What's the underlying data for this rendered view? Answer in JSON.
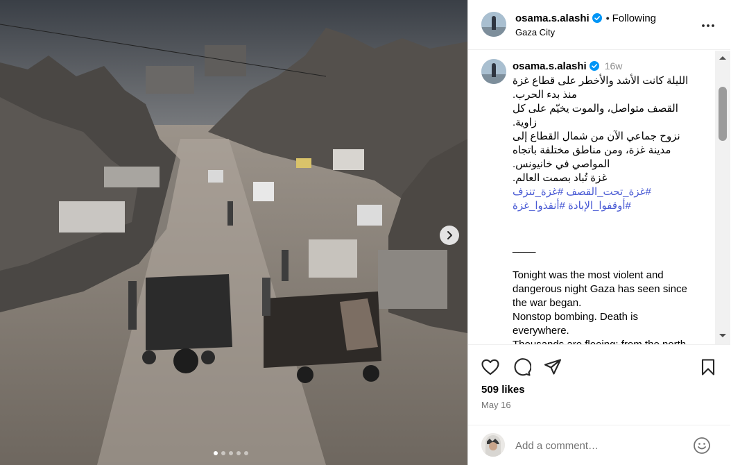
{
  "post": {
    "username": "osama.s.alashi",
    "follow_separator": "•",
    "follow_label": "Following",
    "location": "Gaza City",
    "age": "16w",
    "caption_ar": [
      "الليلة كانت الأشد والأخطر على قطاع غزة منذ بدء الحرب.",
      "القصف متواصل، والموت يخيّم على كل زاوية.",
      "نزوح جماعي الآن من شمال القطاع إلى مدينة غزة، ومن مناطق مختلفة باتجاه المواصي في خانيونس.",
      "غزة تُباد بصمت العالم."
    ],
    "hashtags": "#غزة_تحت_القصف #غزة_تنزف #أوقفوا_الإبادة #أنقذوا_غزة",
    "divider": "____",
    "caption_en": [
      "Tonight was the most violent and dangerous night Gaza has seen since the war began.",
      "Nonstop bombing. Death is everywhere.",
      "Thousands are fleeing: from the north to Gaza City, and toward Al-Mawasi in Khan Younis."
    ],
    "likes": "509 likes",
    "date": "May 16",
    "comment_placeholder": "Add a comment…"
  },
  "icons": {
    "verified": "verified-badge-icon",
    "more": "more-options-icon",
    "like": "heart-icon",
    "comment": "comment-icon",
    "share": "share-icon",
    "save": "bookmark-icon",
    "emoji": "emoji-icon",
    "next": "chevron-right-icon"
  },
  "carousel": {
    "total": 5,
    "active": 1
  },
  "colors": {
    "verified": "#0095f6",
    "hashtag": "#4a5bd4",
    "muted": "#737373"
  }
}
